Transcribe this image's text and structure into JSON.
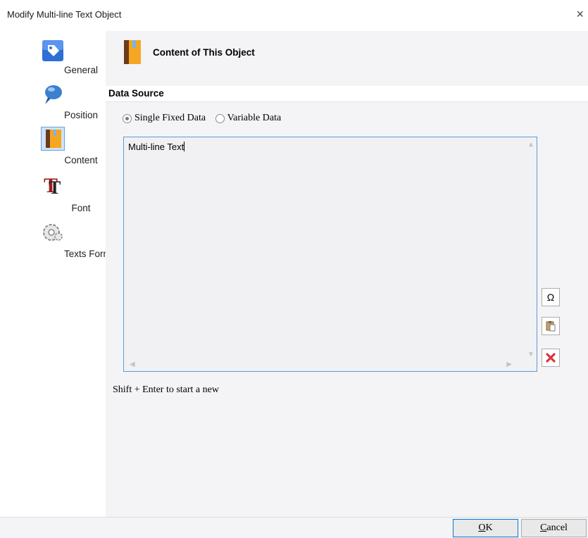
{
  "window": {
    "title": "Modify Multi-line Text Object",
    "close_glyph": "×"
  },
  "sidebar": {
    "items": [
      {
        "label": "General",
        "icon": "tag-icon"
      },
      {
        "label": "Position",
        "icon": "pin-icon"
      },
      {
        "label": "Content",
        "icon": "book-icon"
      },
      {
        "label": "Font",
        "icon": "font-icon"
      },
      {
        "label": "Texts Format",
        "icon": "gear-icon"
      }
    ]
  },
  "header": {
    "title": "Content of This Object"
  },
  "data_source": {
    "section_title": "Data Source",
    "options": [
      {
        "label": "Single Fixed Data",
        "selected": true
      },
      {
        "label": "Variable Data",
        "selected": false
      }
    ],
    "text_value": "Multi-line Text"
  },
  "tools": {
    "omega_glyph": "Ω"
  },
  "hint": "Shift + Enter to start a new",
  "footer": {
    "ok_label": "OK",
    "cancel_label": "Cancel"
  },
  "colors": {
    "accent": "#5b9bd5",
    "panel_bg": "#f4f4f6",
    "delete_red": "#d9363e"
  }
}
